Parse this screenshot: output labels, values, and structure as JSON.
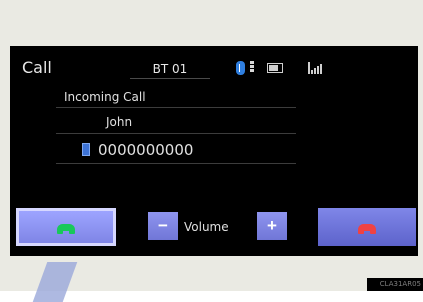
{
  "header": {
    "title": "Call",
    "device_name": "BT 01",
    "icons": [
      "bluetooth-icon",
      "signal-bars-icon",
      "battery-icon",
      "signal-strength-icon"
    ]
  },
  "call": {
    "status": "Incoming Call",
    "caller_name": "John",
    "number": "0000000000",
    "number_icon": "mobile-phone-icon"
  },
  "controls": {
    "accept_icon": "accept-call-icon",
    "decline_icon": "end-call-icon",
    "volume_down": "−",
    "volume_label": "Volume",
    "volume_up": "+"
  },
  "footer": {
    "code": "CLA31AR05"
  },
  "colors": {
    "screen_bg": "#000000",
    "button_blue": "#7f85e6",
    "accept_green": "#19c85a",
    "decline_red": "#f04242",
    "bluetooth_blue": "#2f7fe0"
  }
}
